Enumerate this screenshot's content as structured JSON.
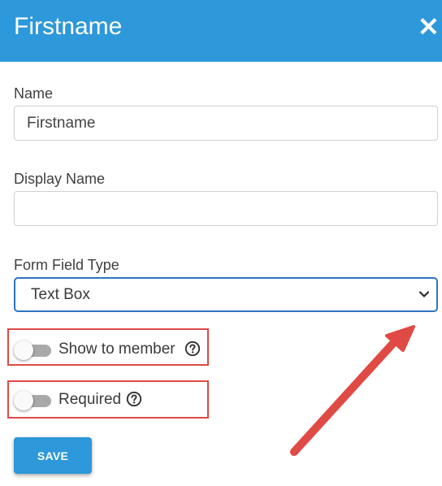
{
  "header": {
    "title": "Firstname",
    "close_icon": "close-icon",
    "background_color": "#2d98da"
  },
  "form": {
    "name": {
      "label": "Name",
      "value": "Firstname"
    },
    "display_name": {
      "label": "Display Name",
      "value": ""
    },
    "form_field_type": {
      "label": "Form Field Type",
      "selected": "Text Box"
    },
    "show_to_member": {
      "label": "Show to member",
      "checked": false,
      "help_icon": "question-circle-icon"
    },
    "required": {
      "label": "Required",
      "checked": false,
      "help_icon": "question-circle-icon"
    },
    "save_label": "SAVE"
  },
  "annotations": {
    "highlight_color": "#dc4a46",
    "arrow_color": "#e04a45"
  }
}
